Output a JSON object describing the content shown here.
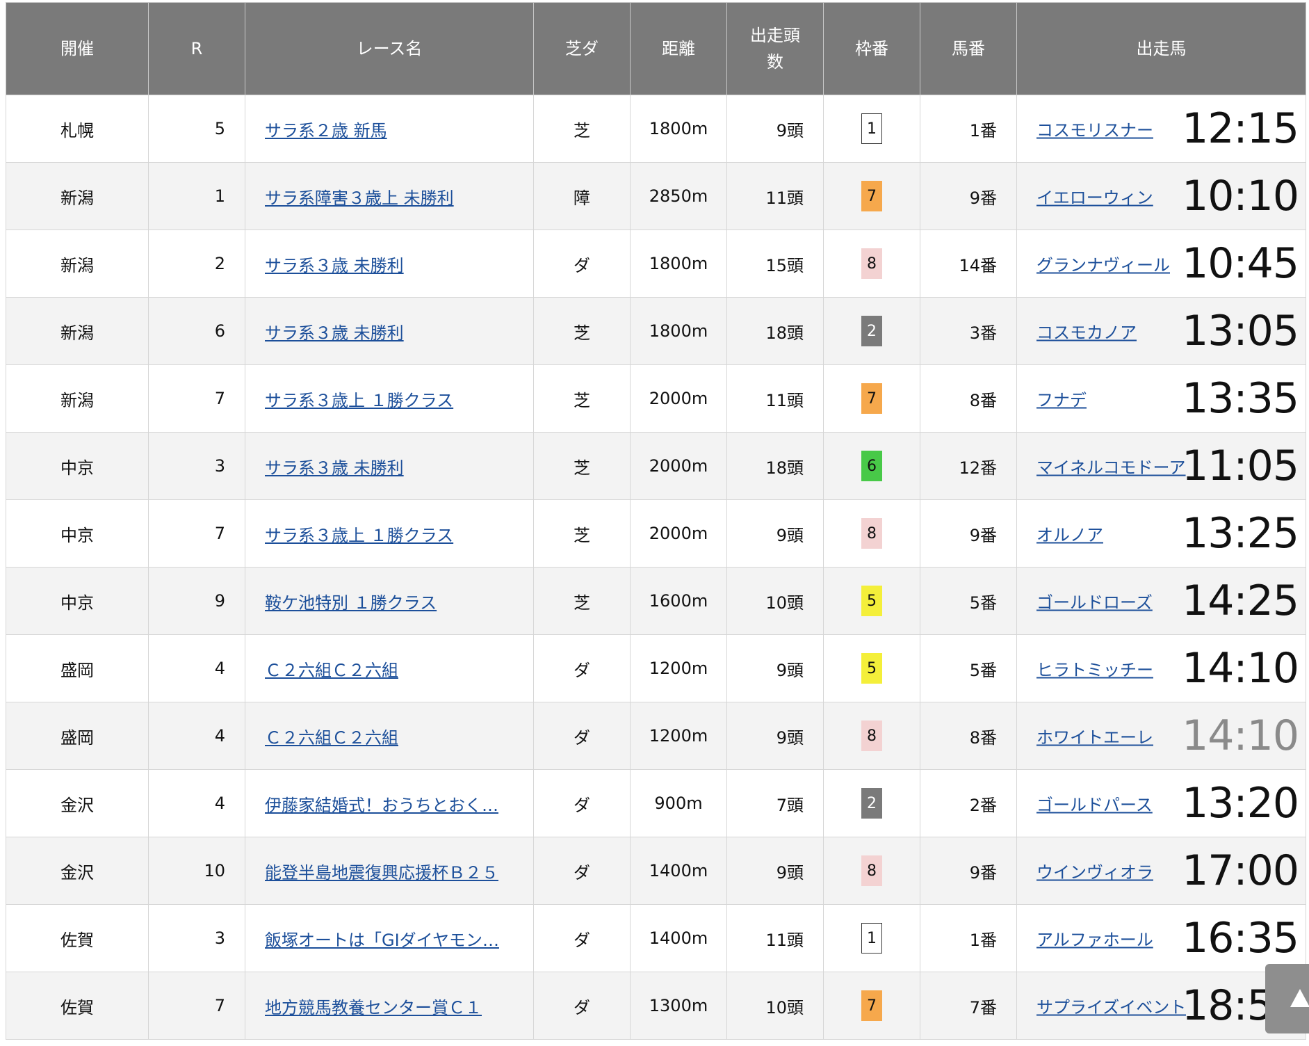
{
  "headers": [
    "開催",
    "R",
    "レース名",
    "芝ダ",
    "距離",
    "出走頭数",
    "枠番",
    "馬番",
    "出走馬"
  ],
  "waku_colors": {
    "1": {
      "bg": "#ffffff",
      "fg": "#111111",
      "border": "#333333"
    },
    "2": {
      "bg": "#7a7a7a",
      "fg": "#ffffff",
      "border": "#7a7a7a"
    },
    "5": {
      "bg": "#f4ef3a",
      "fg": "#111111",
      "border": "#f4ef3a"
    },
    "6": {
      "bg": "#48c948",
      "fg": "#111111",
      "border": "#48c948"
    },
    "7": {
      "bg": "#f6a84c",
      "fg": "#111111",
      "border": "#f6a84c"
    },
    "8": {
      "bg": "#f3d2d2",
      "fg": "#111111",
      "border": "#f3d2d2"
    }
  },
  "rows": [
    {
      "venue": "札幌",
      "r": "5",
      "race": "サラ系２歳 新馬",
      "surface": "芝",
      "distance": "1800m",
      "runners": "9頭",
      "waku": "1",
      "umaban": "1番",
      "horse": "コスモリスナー",
      "time": "12:15",
      "dim": false
    },
    {
      "venue": "新潟",
      "r": "1",
      "race": "サラ系障害３歳上 未勝利",
      "surface": "障",
      "distance": "2850m",
      "runners": "11頭",
      "waku": "7",
      "umaban": "9番",
      "horse": "イエローウィン",
      "time": "10:10",
      "dim": false
    },
    {
      "venue": "新潟",
      "r": "2",
      "race": "サラ系３歳 未勝利",
      "surface": "ダ",
      "distance": "1800m",
      "runners": "15頭",
      "waku": "8",
      "umaban": "14番",
      "horse": "グランナヴィール",
      "time": "10:45",
      "dim": false
    },
    {
      "venue": "新潟",
      "r": "6",
      "race": "サラ系３歳 未勝利",
      "surface": "芝",
      "distance": "1800m",
      "runners": "18頭",
      "waku": "2",
      "umaban": "3番",
      "horse": "コスモカノア",
      "time": "13:05",
      "dim": false
    },
    {
      "venue": "新潟",
      "r": "7",
      "race": "サラ系３歳上 １勝クラス",
      "surface": "芝",
      "distance": "2000m",
      "runners": "11頭",
      "waku": "7",
      "umaban": "8番",
      "horse": "フナデ",
      "time": "13:35",
      "dim": false
    },
    {
      "venue": "中京",
      "r": "3",
      "race": "サラ系３歳 未勝利",
      "surface": "芝",
      "distance": "2000m",
      "runners": "18頭",
      "waku": "6",
      "umaban": "12番",
      "horse": "マイネルコモドーア",
      "time": "11:05",
      "dim": false
    },
    {
      "venue": "中京",
      "r": "7",
      "race": "サラ系３歳上 １勝クラス",
      "surface": "芝",
      "distance": "2000m",
      "runners": "9頭",
      "waku": "8",
      "umaban": "9番",
      "horse": "オルノア",
      "time": "13:25",
      "dim": false
    },
    {
      "venue": "中京",
      "r": "9",
      "race": "鞍ケ池特別 １勝クラス",
      "surface": "芝",
      "distance": "1600m",
      "runners": "10頭",
      "waku": "5",
      "umaban": "5番",
      "horse": "ゴールドローズ",
      "time": "14:25",
      "dim": false
    },
    {
      "venue": "盛岡",
      "r": "4",
      "race": "Ｃ２六組Ｃ２六組",
      "surface": "ダ",
      "distance": "1200m",
      "runners": "9頭",
      "waku": "5",
      "umaban": "5番",
      "horse": "ヒラトミッチー",
      "time": "14:10",
      "dim": false
    },
    {
      "venue": "盛岡",
      "r": "4",
      "race": "Ｃ２六組Ｃ２六組",
      "surface": "ダ",
      "distance": "1200m",
      "runners": "9頭",
      "waku": "8",
      "umaban": "8番",
      "horse": "ホワイトエーレ",
      "time": "14:10",
      "dim": true
    },
    {
      "venue": "金沢",
      "r": "4",
      "race": "伊藤家結婚式！おうちとおく…",
      "surface": "ダ",
      "distance": "900m",
      "runners": "7頭",
      "waku": "2",
      "umaban": "2番",
      "horse": "ゴールドパース",
      "time": "13:20",
      "dim": false
    },
    {
      "venue": "金沢",
      "r": "10",
      "race": "能登半島地震復興応援杯Ｂ２５",
      "surface": "ダ",
      "distance": "1400m",
      "runners": "9頭",
      "waku": "8",
      "umaban": "9番",
      "horse": "ウインヴィオラ",
      "time": "17:00",
      "dim": false
    },
    {
      "venue": "佐賀",
      "r": "3",
      "race": "飯塚オートは「GIダイヤモン…",
      "surface": "ダ",
      "distance": "1400m",
      "runners": "11頭",
      "waku": "1",
      "umaban": "1番",
      "horse": "アルファホール",
      "time": "16:35",
      "dim": false
    },
    {
      "venue": "佐賀",
      "r": "7",
      "race": "地方競馬教養センター賞Ｃ１",
      "surface": "ダ",
      "distance": "1300m",
      "runners": "10頭",
      "waku": "7",
      "umaban": "7番",
      "horse": "サプライズイベント",
      "time": "18:50",
      "dim": false
    }
  ]
}
